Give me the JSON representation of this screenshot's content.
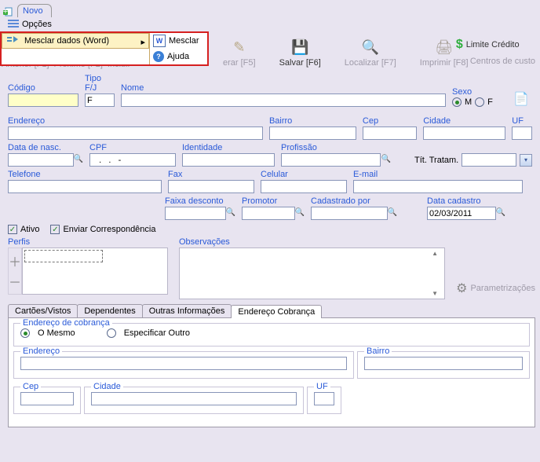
{
  "tab": {
    "novo": "Novo"
  },
  "menu": {
    "opcoes": "Opções"
  },
  "dropdown": {
    "mesclar_dados": "Mesclar dados (Word)",
    "sub_mesclar": "Mesclar",
    "sub_ajuda": "Ajuda"
  },
  "nav": {
    "anterior": "Anterior [F1]",
    "proximo": "Próximo [F2]",
    "incluir": "Incluir",
    "erar": "erar [F5]",
    "salvar": "Salvar [F6]",
    "localizar": "Localizar [F7]",
    "imprimir": "Imprimir [F8]"
  },
  "right": {
    "limite": "Limite Crédito",
    "centros": "Centros de custo"
  },
  "labels": {
    "codigo": "Código",
    "tipofj": "Tipo F/J",
    "nome": "Nome",
    "sexo": "Sexo",
    "m": "M",
    "f": "F",
    "endereco": "Endereço",
    "bairro": "Bairro",
    "cep": "Cep",
    "cidade": "Cidade",
    "uf": "UF",
    "data_nasc": "Data de nasc.",
    "cpf": "CPF",
    "identidade": "Identidade",
    "profissao": "Profissão",
    "tit_tratam": "Tít. Tratam.",
    "telefone": "Telefone",
    "fax": "Fax",
    "celular": "Celular",
    "email": "E-mail",
    "faixa": "Faixa desconto",
    "promotor": "Promotor",
    "cadastrado_por": "Cadastrado por",
    "data_cadastro": "Data cadastro",
    "ativo": "Ativo",
    "enviar": "Enviar Correspondência",
    "perfis": "Perfis",
    "obs": "Observações",
    "param": "Parametrizações"
  },
  "values": {
    "tipofj": "F",
    "cpf": "   .   .   -",
    "data_cadastro": "02/03/2011"
  },
  "tabs2": {
    "cartoes": "Cartões/Vistos",
    "dependentes": "Dependentes",
    "outras": "Outras Informações",
    "end_cobr": "Endereço Cobrança"
  },
  "cobranca": {
    "legend": "Endereço de cobrança",
    "omesmo": "O Mesmo",
    "espec": "Especificar Outro",
    "endereco": "Endereço",
    "bairro": "Bairro",
    "cep": "Cep",
    "cidade": "Cidade",
    "uf": "UF"
  }
}
